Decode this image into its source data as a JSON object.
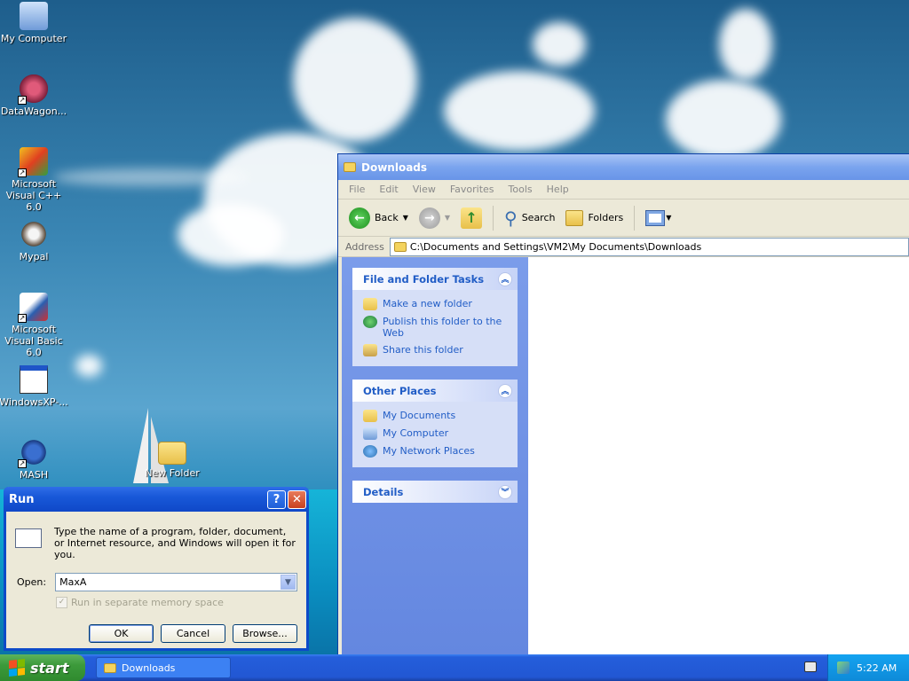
{
  "desktop": {
    "icons": [
      {
        "label": "My Computer"
      },
      {
        "label": "DataWagon..."
      },
      {
        "label": "Microsoft Visual C++ 6.0"
      },
      {
        "label": "Mypal"
      },
      {
        "label": "Microsoft Visual Basic 6.0"
      },
      {
        "label": "WindowsXP-..."
      },
      {
        "label": "MASH"
      },
      {
        "label": "New Folder"
      }
    ]
  },
  "explorer": {
    "title": "Downloads",
    "menu": [
      "File",
      "Edit",
      "View",
      "Favorites",
      "Tools",
      "Help"
    ],
    "toolbar": {
      "back": "Back",
      "search": "Search",
      "folders": "Folders"
    },
    "address": {
      "label": "Address",
      "value": "C:\\Documents and Settings\\VM2\\My Documents\\Downloads"
    },
    "panels": {
      "file_tasks": {
        "title": "File and Folder Tasks",
        "items": [
          "Make a new folder",
          "Publish this folder to the Web",
          "Share this folder"
        ]
      },
      "other_places": {
        "title": "Other Places",
        "items": [
          "My Documents",
          "My Computer",
          "My Network Places"
        ]
      },
      "details": {
        "title": "Details"
      }
    }
  },
  "run_dialog": {
    "title": "Run",
    "help_glyph": "?",
    "close_glyph": "✕",
    "description": "Type the name of a program, folder, document, or Internet resource, and Windows will open it for you.",
    "open_label": "Open:",
    "open_value": "MaxA",
    "checkbox_label": "Run in separate memory space",
    "ok": "OK",
    "cancel": "Cancel",
    "browse": "Browse..."
  },
  "taskbar": {
    "start": "start",
    "task_button": "Downloads",
    "clock": "5:22 AM"
  },
  "colors": {
    "xp_blue": "#0f48c8",
    "start_green": "#3c9a3b",
    "link_blue": "#215dc6"
  }
}
